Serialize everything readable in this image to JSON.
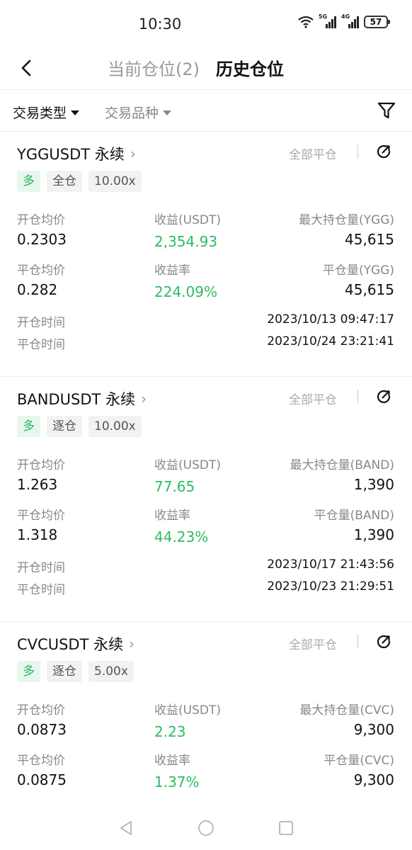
{
  "status": {
    "time": "10:30",
    "battery": "57",
    "sig1": "5G",
    "sig2": "4G"
  },
  "nav": {
    "tab_current": "当前仓位(2)",
    "tab_history": "历史仓位"
  },
  "filters": {
    "type_label": "交易类型",
    "symbol_label": "交易品种"
  },
  "labels": {
    "close_all": "全部平仓",
    "open_avg": "开仓均价",
    "pnl": "收益(USDT)",
    "close_avg": "平仓均价",
    "pnl_rate": "收益率",
    "open_time": "开仓时间",
    "close_time": "平仓时间"
  },
  "colors": {
    "profit_green": "#2cbc63",
    "tag_green_bg": "#e8f7ee"
  },
  "positions": [
    {
      "title": "YGGUSDT 永续",
      "side": "多",
      "margin": "全仓",
      "leverage": "10.00x",
      "open_avg": "0.2303",
      "pnl": "2,354.93",
      "max_hold_label": "最大持仓量(YGG)",
      "max_hold": "45,615",
      "close_avg": "0.282",
      "pnl_rate": "224.09%",
      "close_qty_label": "平仓量(YGG)",
      "close_qty": "45,615",
      "open_time": "2023/10/13 09:47:17",
      "close_time": "2023/10/24 23:21:41"
    },
    {
      "title": "BANDUSDT 永续",
      "side": "多",
      "margin": "逐仓",
      "leverage": "10.00x",
      "open_avg": "1.263",
      "pnl": "77.65",
      "max_hold_label": "最大持仓量(BAND)",
      "max_hold": "1,390",
      "close_avg": "1.318",
      "pnl_rate": "44.23%",
      "close_qty_label": "平仓量(BAND)",
      "close_qty": "1,390",
      "open_time": "2023/10/17 21:43:56",
      "close_time": "2023/10/23 21:29:51"
    },
    {
      "title": "CVCUSDT 永续",
      "side": "多",
      "margin": "逐仓",
      "leverage": "5.00x",
      "open_avg": "0.0873",
      "pnl": "2.23",
      "max_hold_label": "最大持仓量(CVC)",
      "max_hold": "9,300",
      "close_avg": "0.0875",
      "pnl_rate": "1.37%",
      "close_qty_label": "平仓量(CVC)",
      "close_qty": "9,300",
      "open_time": "",
      "close_time": ""
    }
  ],
  "icons": {
    "back": "chevron-left-icon",
    "filter": "funnel-icon",
    "share": "share-icon",
    "nav_back": "triangle-back-icon",
    "nav_home": "circle-home-icon",
    "nav_recent": "square-recent-icon"
  }
}
